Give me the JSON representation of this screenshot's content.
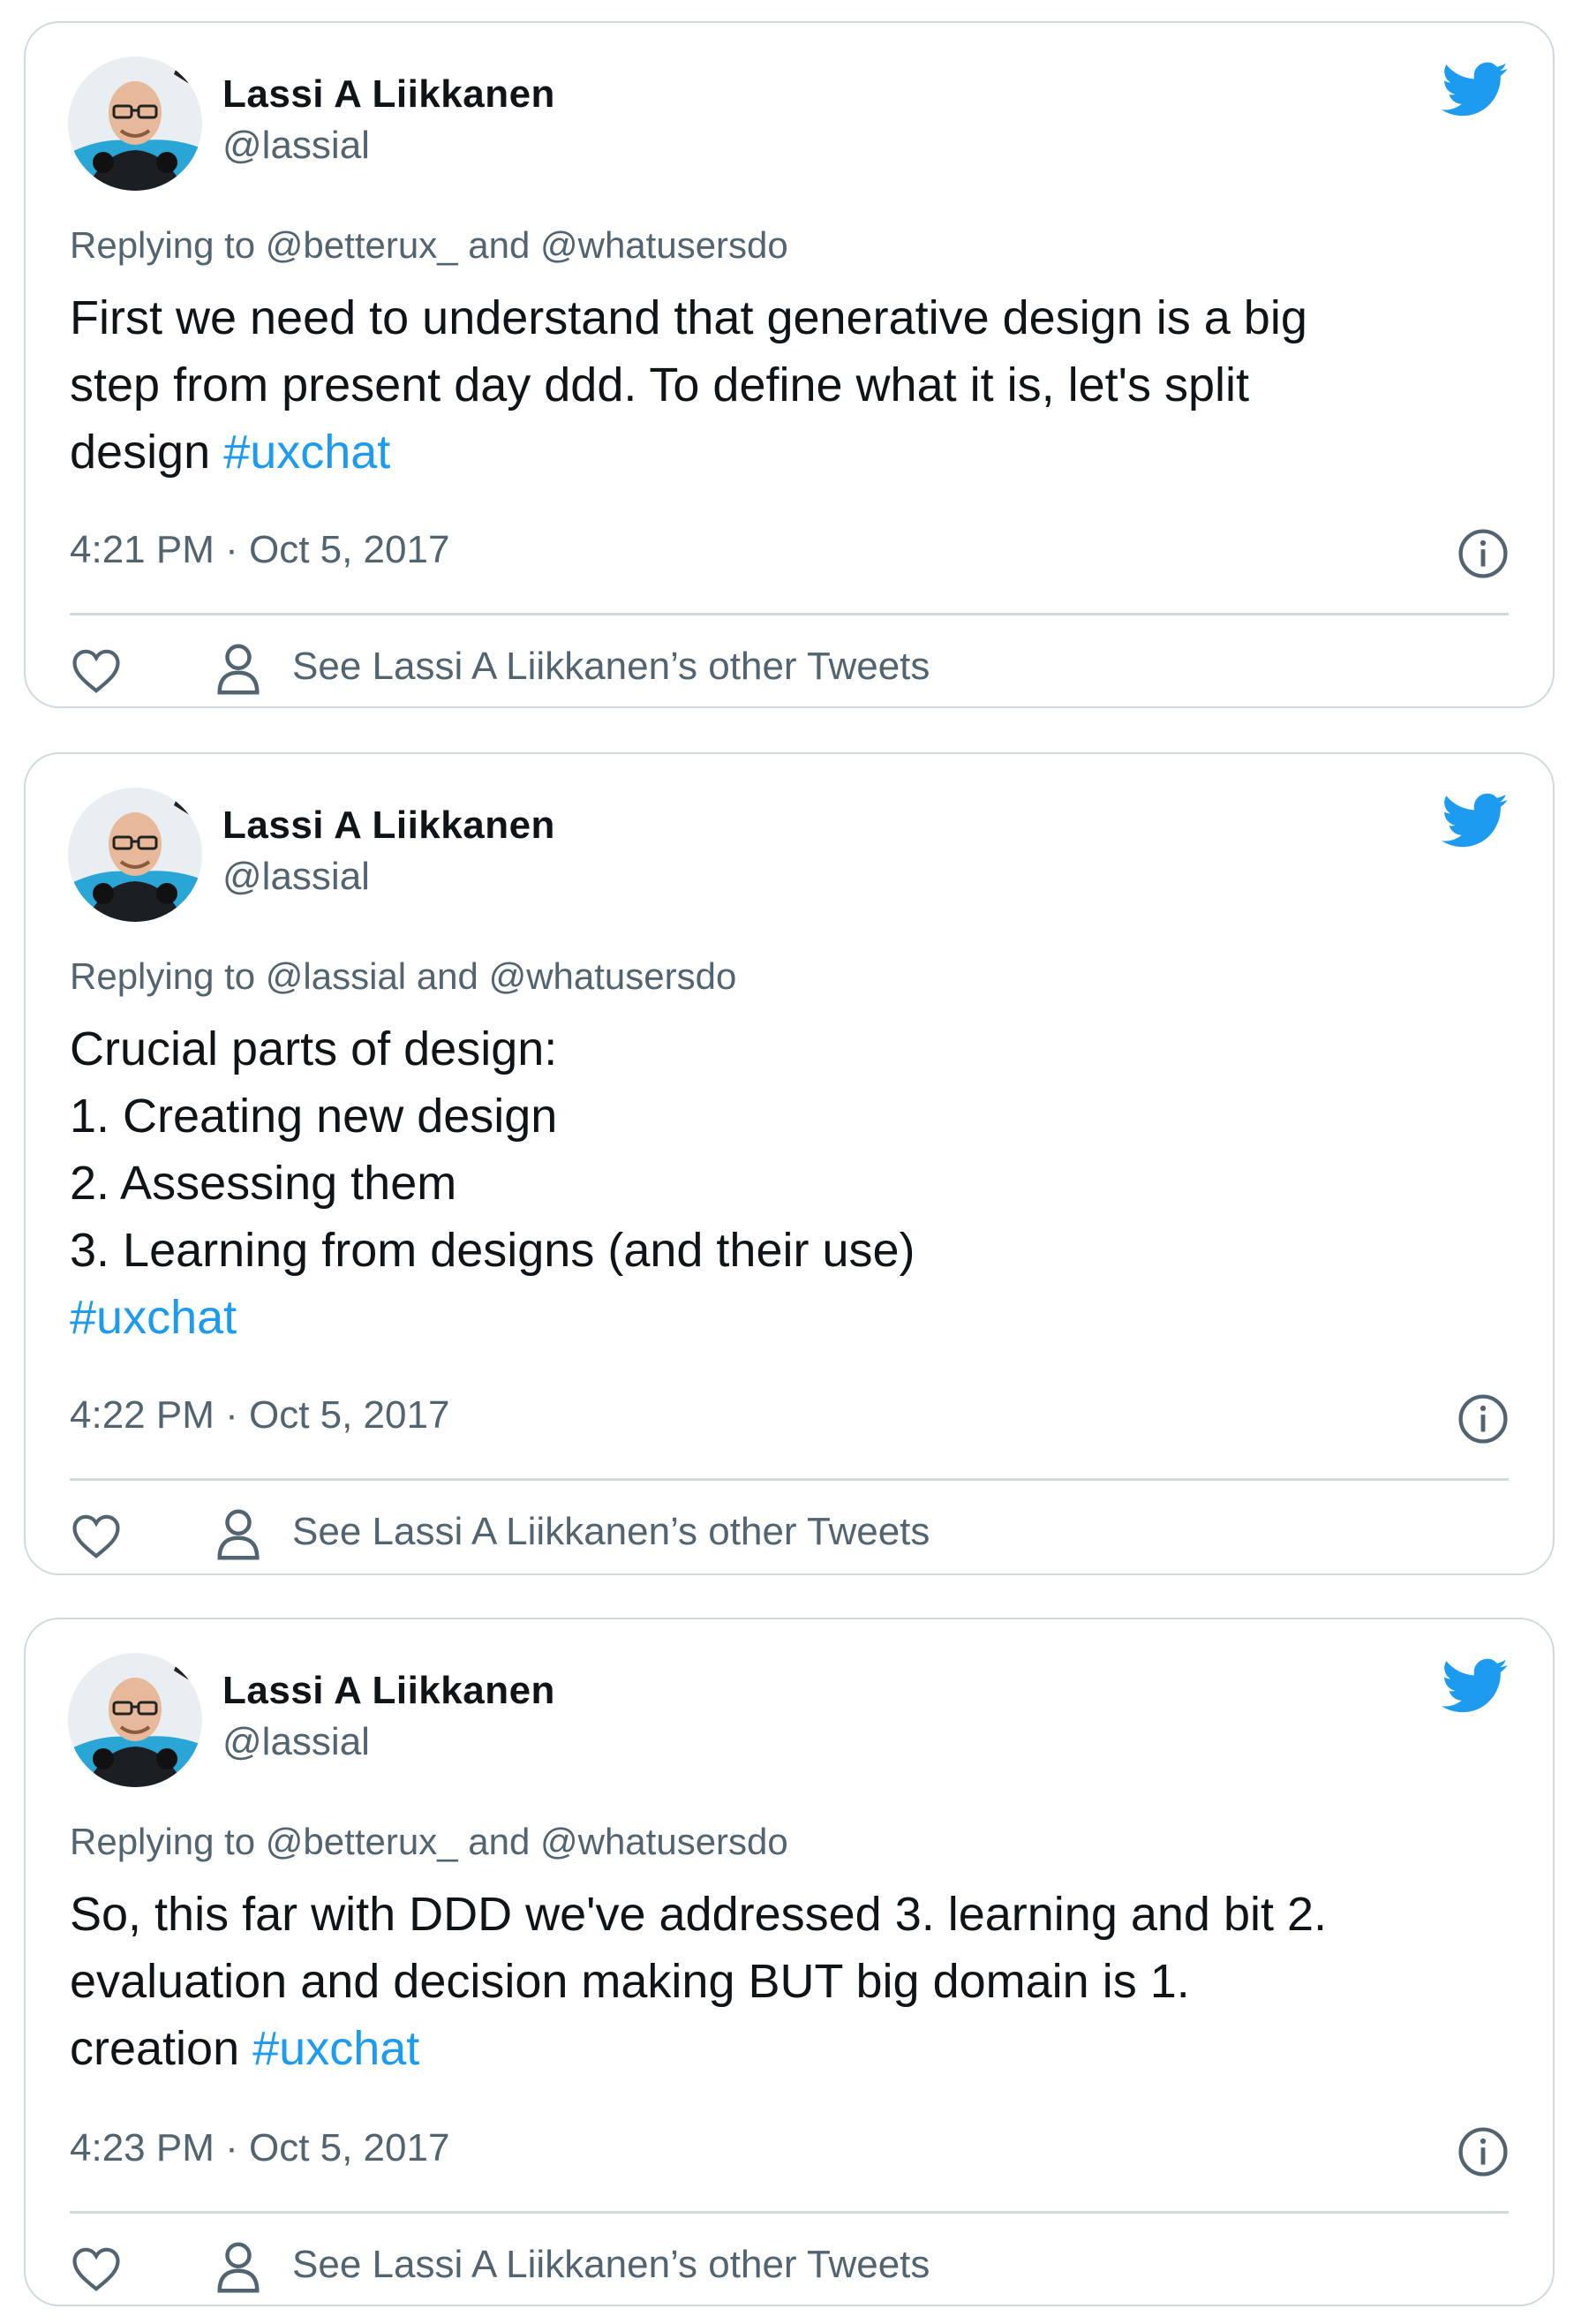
{
  "colors": {
    "accent": "#1d9bf0",
    "text_primary": "#0f1419",
    "text_secondary": "#536471",
    "border": "#cfd9de"
  },
  "icons": {
    "brand": "twitter-bird-icon",
    "info": "info-icon",
    "like": "heart-icon",
    "profile": "person-icon"
  },
  "tweets": [
    {
      "author_name": "Lassi A Liikkanen",
      "author_handle": "@lassial",
      "replying_prefix": "Replying to",
      "replying_mention_1": "@betterux_",
      "replying_and": "and",
      "replying_mention_2": "@whatusersdo",
      "lines": [
        "First we need to understand that generative design is a big",
        "step from present day ddd. To define what it is, let's split",
        "design"
      ],
      "hashtag": "#uxchat",
      "timestamp": "4:21 PM · Oct 5, 2017",
      "other_tweets_label": "See Lassi A Liikkanen’s other Tweets"
    },
    {
      "author_name": "Lassi A Liikkanen",
      "author_handle": "@lassial",
      "replying_prefix": "Replying to",
      "replying_mention_1": "@lassial",
      "replying_and": "and",
      "replying_mention_2": "@whatusersdo",
      "lines": [
        "Crucial parts of design:",
        "1. Creating new design",
        "2. Assessing them",
        "3. Learning from designs (and their use)"
      ],
      "hashtag": "#uxchat",
      "timestamp": "4:22 PM · Oct 5, 2017",
      "other_tweets_label": "See Lassi A Liikkanen’s other Tweets"
    },
    {
      "author_name": "Lassi A Liikkanen",
      "author_handle": "@lassial",
      "replying_prefix": "Replying to",
      "replying_mention_1": "@betterux_",
      "replying_and": "and",
      "replying_mention_2": "@whatusersdo",
      "lines": [
        "So, this far with DDD we've addressed 3. learning and bit 2.",
        "evaluation and decision making BUT big domain is 1.",
        "creation"
      ],
      "hashtag": "#uxchat",
      "timestamp": "4:23 PM · Oct 5, 2017",
      "other_tweets_label": "See Lassi A Liikkanen’s other Tweets"
    }
  ]
}
